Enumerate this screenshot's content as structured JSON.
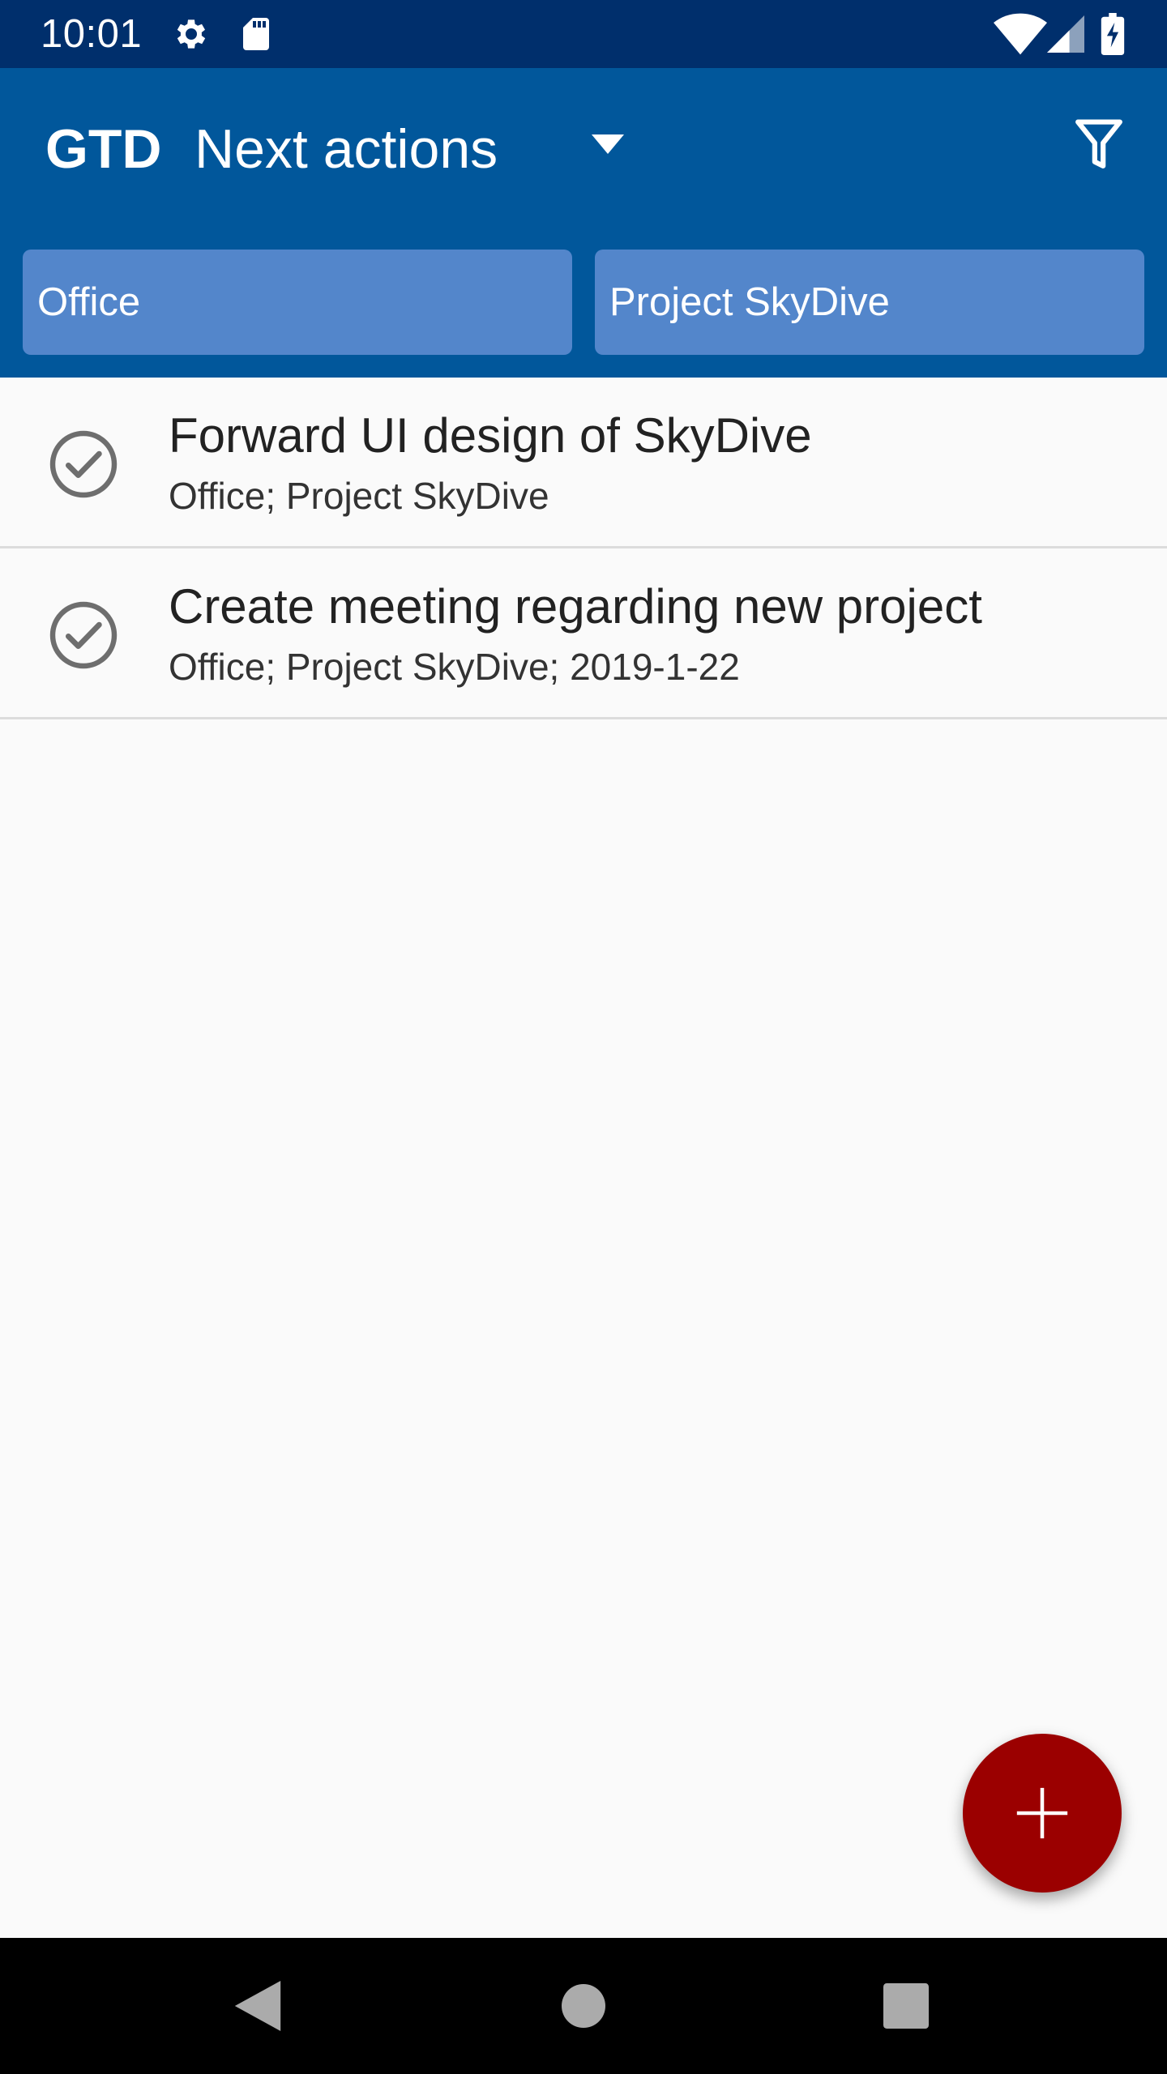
{
  "status_bar": {
    "time": "10:01",
    "left_icons": [
      "settings-icon",
      "sd-card-icon"
    ],
    "right_icons": [
      "wifi-icon",
      "cell-signal-icon",
      "battery-charging-icon"
    ]
  },
  "app_bar": {
    "app_name": "GTD",
    "list_label": "Next actions",
    "dropdown_icon": "dropdown-arrow-icon",
    "filter_icon": "filter-icon"
  },
  "filters": {
    "chips": [
      "Office",
      "Project SkyDive"
    ]
  },
  "tasks": [
    {
      "title": "Forward UI design of SkyDive",
      "meta": "Office; Project SkyDive"
    },
    {
      "title": "Create meeting regarding new project",
      "meta": "Office; Project SkyDive; 2019-1-22"
    }
  ],
  "fab": {
    "icon": "add-icon"
  },
  "nav_bar": {
    "icons": [
      "back-icon",
      "home-icon",
      "recents-icon"
    ]
  },
  "colors": {
    "status_bar": "#002f6c",
    "app_bar": "#01579b",
    "chip": "#5386cb",
    "fab": "#9b0000",
    "background": "#fafafa"
  }
}
